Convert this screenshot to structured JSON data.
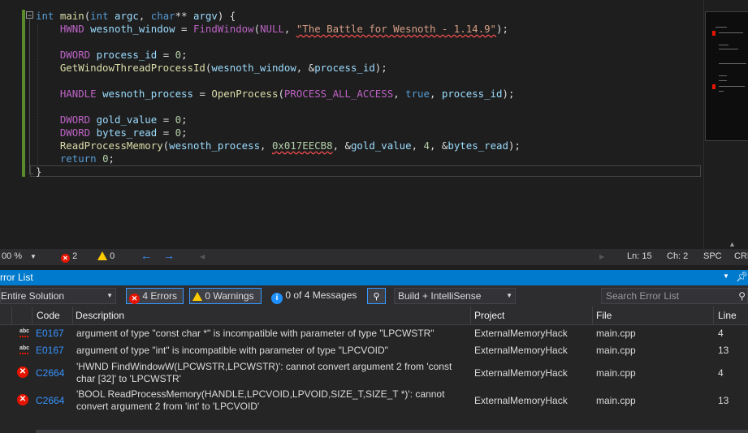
{
  "code": {
    "lines": [
      [
        {
          "t": "int",
          "c": "kw"
        },
        {
          "t": " "
        },
        {
          "t": "main",
          "c": "fn"
        },
        {
          "t": "("
        },
        {
          "t": "int",
          "c": "kw"
        },
        {
          "t": " "
        },
        {
          "t": "argc",
          "c": "id"
        },
        {
          "t": ", "
        },
        {
          "t": "char",
          "c": "kw"
        },
        {
          "t": "** "
        },
        {
          "t": "argv",
          "c": "id"
        },
        {
          "t": ") {"
        }
      ],
      [
        {
          "t": "    "
        },
        {
          "t": "HWND",
          "c": "mac"
        },
        {
          "t": " "
        },
        {
          "t": "wesnoth_window",
          "c": "id"
        },
        {
          "t": " = "
        },
        {
          "t": "FindWindow",
          "c": "mac"
        },
        {
          "t": "("
        },
        {
          "t": "NULL",
          "c": "mac"
        },
        {
          "t": ", "
        },
        {
          "t": "\"The Battle for Wesnoth - 1.14.9\"",
          "c": "str sq"
        },
        {
          "t": ");"
        }
      ],
      [],
      [
        {
          "t": "    "
        },
        {
          "t": "DWORD",
          "c": "mac"
        },
        {
          "t": " "
        },
        {
          "t": "process_id",
          "c": "id"
        },
        {
          "t": " = "
        },
        {
          "t": "0",
          "c": "num"
        },
        {
          "t": ";"
        }
      ],
      [
        {
          "t": "    "
        },
        {
          "t": "GetWindowThreadProcessId",
          "c": "fn"
        },
        {
          "t": "("
        },
        {
          "t": "wesnoth_window",
          "c": "id"
        },
        {
          "t": ", &"
        },
        {
          "t": "process_id",
          "c": "id"
        },
        {
          "t": ");"
        }
      ],
      [],
      [
        {
          "t": "    "
        },
        {
          "t": "HANDLE",
          "c": "mac"
        },
        {
          "t": " "
        },
        {
          "t": "wesnoth_process",
          "c": "id"
        },
        {
          "t": " = "
        },
        {
          "t": "OpenProcess",
          "c": "fn"
        },
        {
          "t": "("
        },
        {
          "t": "PROCESS_ALL_ACCESS",
          "c": "mac"
        },
        {
          "t": ", "
        },
        {
          "t": "true",
          "c": "kw"
        },
        {
          "t": ", "
        },
        {
          "t": "process_id",
          "c": "id"
        },
        {
          "t": ");"
        }
      ],
      [],
      [
        {
          "t": "    "
        },
        {
          "t": "DWORD",
          "c": "mac"
        },
        {
          "t": " "
        },
        {
          "t": "gold_value",
          "c": "id"
        },
        {
          "t": " = "
        },
        {
          "t": "0",
          "c": "num"
        },
        {
          "t": ";"
        }
      ],
      [
        {
          "t": "    "
        },
        {
          "t": "DWORD",
          "c": "mac"
        },
        {
          "t": " "
        },
        {
          "t": "bytes_read",
          "c": "id"
        },
        {
          "t": " = "
        },
        {
          "t": "0",
          "c": "num"
        },
        {
          "t": ";"
        }
      ],
      [
        {
          "t": "    "
        },
        {
          "t": "ReadProcessMemory",
          "c": "fn"
        },
        {
          "t": "("
        },
        {
          "t": "wesnoth_process",
          "c": "id"
        },
        {
          "t": ", "
        },
        {
          "t": "0x017EECB8",
          "c": "num sq"
        },
        {
          "t": ", &"
        },
        {
          "t": "gold_value",
          "c": "id"
        },
        {
          "t": ", "
        },
        {
          "t": "4",
          "c": "num"
        },
        {
          "t": ", &"
        },
        {
          "t": "bytes_read",
          "c": "id"
        },
        {
          "t": ");"
        }
      ],
      [
        {
          "t": "    "
        },
        {
          "t": "return",
          "c": "kw"
        },
        {
          "t": " "
        },
        {
          "t": "0",
          "c": "num"
        },
        {
          "t": ";"
        }
      ],
      [
        {
          "t": "}"
        }
      ]
    ]
  },
  "colors": {
    "accent": "#007acc",
    "error": "#e51400",
    "warning": "#ffcc00",
    "link": "#3794ff",
    "change_bar": "#5a8a2c"
  },
  "editor_status": {
    "zoom": "00 %",
    "error_count": "2",
    "warning_count": "0",
    "line": "Ln: 15",
    "col": "Ch: 2",
    "spc": "SPC",
    "crlf": "CRL"
  },
  "error_list": {
    "title": "rror List",
    "scope": "Entire Solution",
    "errors_btn": "4 Errors",
    "warnings_btn": "0 Warnings",
    "messages_btn": "0 of 4 Messages",
    "build_filter": "Build + IntelliSense",
    "search_placeholder": "Search Error List",
    "columns": {
      "code": "Code",
      "description": "Description",
      "project": "Project",
      "file": "File",
      "line": "Line"
    },
    "rows": [
      {
        "icon": "intellisense-error-icon",
        "code": "E0167",
        "description": "argument of type \"const char *\" is incompatible with parameter of type \"LPCWSTR\"",
        "project": "ExternalMemoryHack",
        "file": "main.cpp",
        "line": "4"
      },
      {
        "icon": "intellisense-error-icon",
        "code": "E0167",
        "description": "argument of type \"int\" is incompatible with parameter of type \"LPCVOID\"",
        "project": "ExternalMemoryHack",
        "file": "main.cpp",
        "line": "13"
      },
      {
        "icon": "error-icon",
        "code": "C2664",
        "description": "'HWND FindWindowW(LPCWSTR,LPCWSTR)': cannot convert argument 2 from 'const char [32]' to 'LPCWSTR'",
        "project": "ExternalMemoryHack",
        "file": "main.cpp",
        "line": "4"
      },
      {
        "icon": "error-icon",
        "code": "C2664",
        "description": "'BOOL ReadProcessMemory(HANDLE,LPCVOID,LPVOID,SIZE_T,SIZE_T *)': cannot convert argument 2 from 'int' to 'LPCVOID'",
        "project": "ExternalMemoryHack",
        "file": "main.cpp",
        "line": "13"
      }
    ]
  }
}
